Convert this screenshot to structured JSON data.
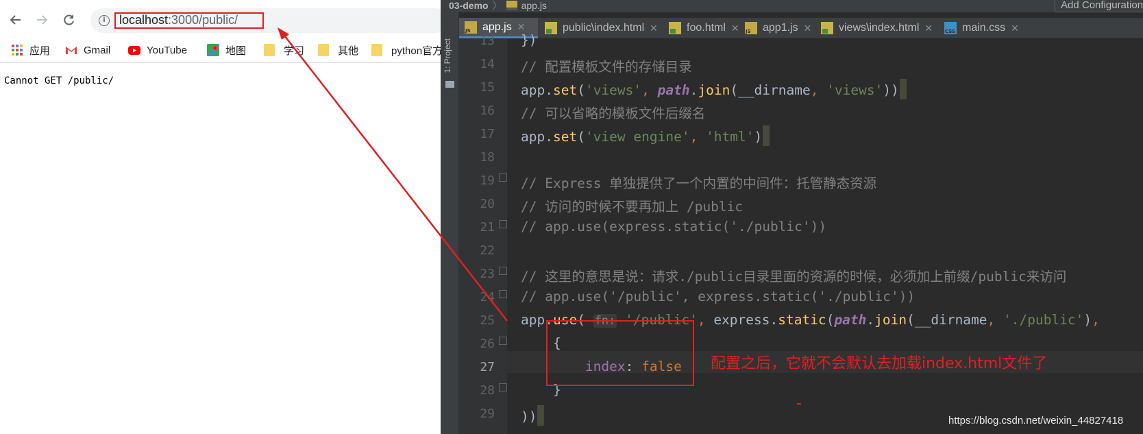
{
  "browser": {
    "url_host": "localhost",
    "url_path": ":3000/public/",
    "page_message": "Cannot GET /public/",
    "bookmarks": [
      {
        "label": "应用",
        "icon": "apps-grid-icon"
      },
      {
        "label": "Gmail",
        "icon": "gmail-icon"
      },
      {
        "label": "YouTube",
        "icon": "youtube-icon"
      },
      {
        "label": "地图",
        "icon": "maps-icon"
      },
      {
        "label": "学习",
        "icon": "folder-icon"
      },
      {
        "label": "其他",
        "icon": "folder-icon"
      },
      {
        "label": "python官方",
        "icon": "folder-icon"
      }
    ]
  },
  "ide": {
    "project_name": "03-demo",
    "breadcrumb_file": "app.js",
    "add_configuration": "Add Configuration...",
    "side_panel_label": "1: Project",
    "tabs": [
      {
        "label": "app.js",
        "type": "js",
        "active": true
      },
      {
        "label": "public\\index.html",
        "type": "html",
        "active": false
      },
      {
        "label": "foo.html",
        "type": "html",
        "active": false
      },
      {
        "label": "app1.js",
        "type": "js",
        "active": false
      },
      {
        "label": "views\\index.html",
        "type": "html",
        "active": false
      },
      {
        "label": "main.css",
        "type": "css",
        "active": false
      }
    ],
    "line_numbers": [
      "13",
      "14",
      "15",
      "16",
      "17",
      "18",
      "19",
      "20",
      "21",
      "22",
      "23",
      "24",
      "25",
      "26",
      "27",
      "28",
      "29"
    ],
    "current_line": "27",
    "code": {
      "l13": "})",
      "l14": "// 配置模板文件的存储目录",
      "l16": "// 可以省略的模板文件后缀名",
      "l19": "// Express 单独提供了一个内置的中间件：托管静态资源",
      "l20": "// 访问的时候不要再加上 /public",
      "l21": "// app.use(express.static('./public'))",
      "l23": "// 这里的意思是说：请求./public目录里面的资源的时候，必须加上前缀/public来访问",
      "l24": "// app.use('/public', express.static('./public'))",
      "inlay_hint": "fn:",
      "index_key": "index",
      "false_kw": "false"
    }
  },
  "annotation": "配置之后，它就不会默认去加载index.html文件了",
  "watermark": "https://blog.csdn.net/weixin_44827418",
  "colors": {
    "highlight_red": "#e02020",
    "ide_background": "#2b2b2b",
    "comment": "#808080",
    "string": "#6a8759",
    "method": "#ffc66d"
  }
}
